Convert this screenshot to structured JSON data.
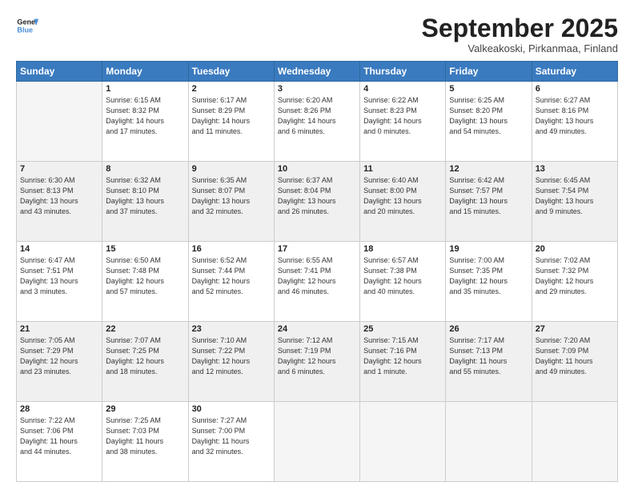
{
  "header": {
    "logo_line1": "General",
    "logo_line2": "Blue",
    "month": "September 2025",
    "location": "Valkeakoski, Pirkanmaa, Finland"
  },
  "days_of_week": [
    "Sunday",
    "Monday",
    "Tuesday",
    "Wednesday",
    "Thursday",
    "Friday",
    "Saturday"
  ],
  "weeks": [
    [
      {
        "day": "",
        "info": ""
      },
      {
        "day": "1",
        "info": "Sunrise: 6:15 AM\nSunset: 8:32 PM\nDaylight: 14 hours\nand 17 minutes."
      },
      {
        "day": "2",
        "info": "Sunrise: 6:17 AM\nSunset: 8:29 PM\nDaylight: 14 hours\nand 11 minutes."
      },
      {
        "day": "3",
        "info": "Sunrise: 6:20 AM\nSunset: 8:26 PM\nDaylight: 14 hours\nand 6 minutes."
      },
      {
        "day": "4",
        "info": "Sunrise: 6:22 AM\nSunset: 8:23 PM\nDaylight: 14 hours\nand 0 minutes."
      },
      {
        "day": "5",
        "info": "Sunrise: 6:25 AM\nSunset: 8:20 PM\nDaylight: 13 hours\nand 54 minutes."
      },
      {
        "day": "6",
        "info": "Sunrise: 6:27 AM\nSunset: 8:16 PM\nDaylight: 13 hours\nand 49 minutes."
      }
    ],
    [
      {
        "day": "7",
        "info": "Sunrise: 6:30 AM\nSunset: 8:13 PM\nDaylight: 13 hours\nand 43 minutes."
      },
      {
        "day": "8",
        "info": "Sunrise: 6:32 AM\nSunset: 8:10 PM\nDaylight: 13 hours\nand 37 minutes."
      },
      {
        "day": "9",
        "info": "Sunrise: 6:35 AM\nSunset: 8:07 PM\nDaylight: 13 hours\nand 32 minutes."
      },
      {
        "day": "10",
        "info": "Sunrise: 6:37 AM\nSunset: 8:04 PM\nDaylight: 13 hours\nand 26 minutes."
      },
      {
        "day": "11",
        "info": "Sunrise: 6:40 AM\nSunset: 8:00 PM\nDaylight: 13 hours\nand 20 minutes."
      },
      {
        "day": "12",
        "info": "Sunrise: 6:42 AM\nSunset: 7:57 PM\nDaylight: 13 hours\nand 15 minutes."
      },
      {
        "day": "13",
        "info": "Sunrise: 6:45 AM\nSunset: 7:54 PM\nDaylight: 13 hours\nand 9 minutes."
      }
    ],
    [
      {
        "day": "14",
        "info": "Sunrise: 6:47 AM\nSunset: 7:51 PM\nDaylight: 13 hours\nand 3 minutes."
      },
      {
        "day": "15",
        "info": "Sunrise: 6:50 AM\nSunset: 7:48 PM\nDaylight: 12 hours\nand 57 minutes."
      },
      {
        "day": "16",
        "info": "Sunrise: 6:52 AM\nSunset: 7:44 PM\nDaylight: 12 hours\nand 52 minutes."
      },
      {
        "day": "17",
        "info": "Sunrise: 6:55 AM\nSunset: 7:41 PM\nDaylight: 12 hours\nand 46 minutes."
      },
      {
        "day": "18",
        "info": "Sunrise: 6:57 AM\nSunset: 7:38 PM\nDaylight: 12 hours\nand 40 minutes."
      },
      {
        "day": "19",
        "info": "Sunrise: 7:00 AM\nSunset: 7:35 PM\nDaylight: 12 hours\nand 35 minutes."
      },
      {
        "day": "20",
        "info": "Sunrise: 7:02 AM\nSunset: 7:32 PM\nDaylight: 12 hours\nand 29 minutes."
      }
    ],
    [
      {
        "day": "21",
        "info": "Sunrise: 7:05 AM\nSunset: 7:29 PM\nDaylight: 12 hours\nand 23 minutes."
      },
      {
        "day": "22",
        "info": "Sunrise: 7:07 AM\nSunset: 7:25 PM\nDaylight: 12 hours\nand 18 minutes."
      },
      {
        "day": "23",
        "info": "Sunrise: 7:10 AM\nSunset: 7:22 PM\nDaylight: 12 hours\nand 12 minutes."
      },
      {
        "day": "24",
        "info": "Sunrise: 7:12 AM\nSunset: 7:19 PM\nDaylight: 12 hours\nand 6 minutes."
      },
      {
        "day": "25",
        "info": "Sunrise: 7:15 AM\nSunset: 7:16 PM\nDaylight: 12 hours\nand 1 minute."
      },
      {
        "day": "26",
        "info": "Sunrise: 7:17 AM\nSunset: 7:13 PM\nDaylight: 11 hours\nand 55 minutes."
      },
      {
        "day": "27",
        "info": "Sunrise: 7:20 AM\nSunset: 7:09 PM\nDaylight: 11 hours\nand 49 minutes."
      }
    ],
    [
      {
        "day": "28",
        "info": "Sunrise: 7:22 AM\nSunset: 7:06 PM\nDaylight: 11 hours\nand 44 minutes."
      },
      {
        "day": "29",
        "info": "Sunrise: 7:25 AM\nSunset: 7:03 PM\nDaylight: 11 hours\nand 38 minutes."
      },
      {
        "day": "30",
        "info": "Sunrise: 7:27 AM\nSunset: 7:00 PM\nDaylight: 11 hours\nand 32 minutes."
      },
      {
        "day": "",
        "info": ""
      },
      {
        "day": "",
        "info": ""
      },
      {
        "day": "",
        "info": ""
      },
      {
        "day": "",
        "info": ""
      }
    ]
  ]
}
